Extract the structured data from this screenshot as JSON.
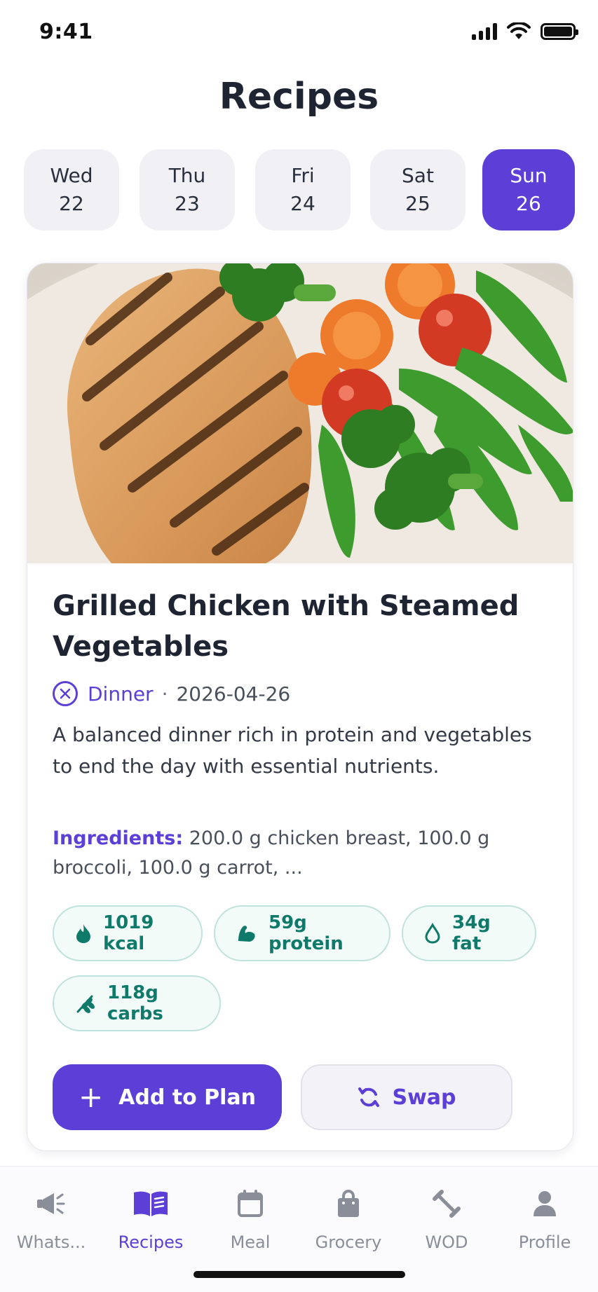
{
  "status": {
    "time": "9:41"
  },
  "page": {
    "title": "Recipes"
  },
  "days": [
    {
      "name": "Wed",
      "num": "22",
      "active": false
    },
    {
      "name": "Thu",
      "num": "23",
      "active": false
    },
    {
      "name": "Fri",
      "num": "24",
      "active": false
    },
    {
      "name": "Sat",
      "num": "25",
      "active": false
    },
    {
      "name": "Sun",
      "num": "26",
      "active": true
    }
  ],
  "recipe": {
    "title": "Grilled Chicken with Steamed Vegetables",
    "category": "Dinner",
    "separator": "·",
    "date": "2026-04-26",
    "description": "A balanced dinner rich in protein and vegetables to end the day with essential nutrients.",
    "ingredients_label": "Ingredients:",
    "ingredients_text": "200.0 g chicken breast, 100.0 g broccoli, 100.0 g carrot, ...",
    "nutrition": {
      "kcal": "1019 kcal",
      "protein": "59g protein",
      "fat": "34g fat",
      "carbs": "118g carbs"
    },
    "add_label": "Add to Plan",
    "swap_label": "Swap"
  },
  "tabs": [
    {
      "label": "Whats...",
      "icon": "megaphone-icon"
    },
    {
      "label": "Recipes",
      "icon": "book-icon",
      "active": true
    },
    {
      "label": "Meal",
      "icon": "calendar-icon"
    },
    {
      "label": "Grocery",
      "icon": "bag-icon"
    },
    {
      "label": "WOD",
      "icon": "dumbbell-icon"
    },
    {
      "label": "Profile",
      "icon": "person-icon"
    }
  ],
  "colors": {
    "accent": "#5b3fd6",
    "chip_text": "#0f7a6a",
    "chip_border": "#bfe2dc"
  }
}
